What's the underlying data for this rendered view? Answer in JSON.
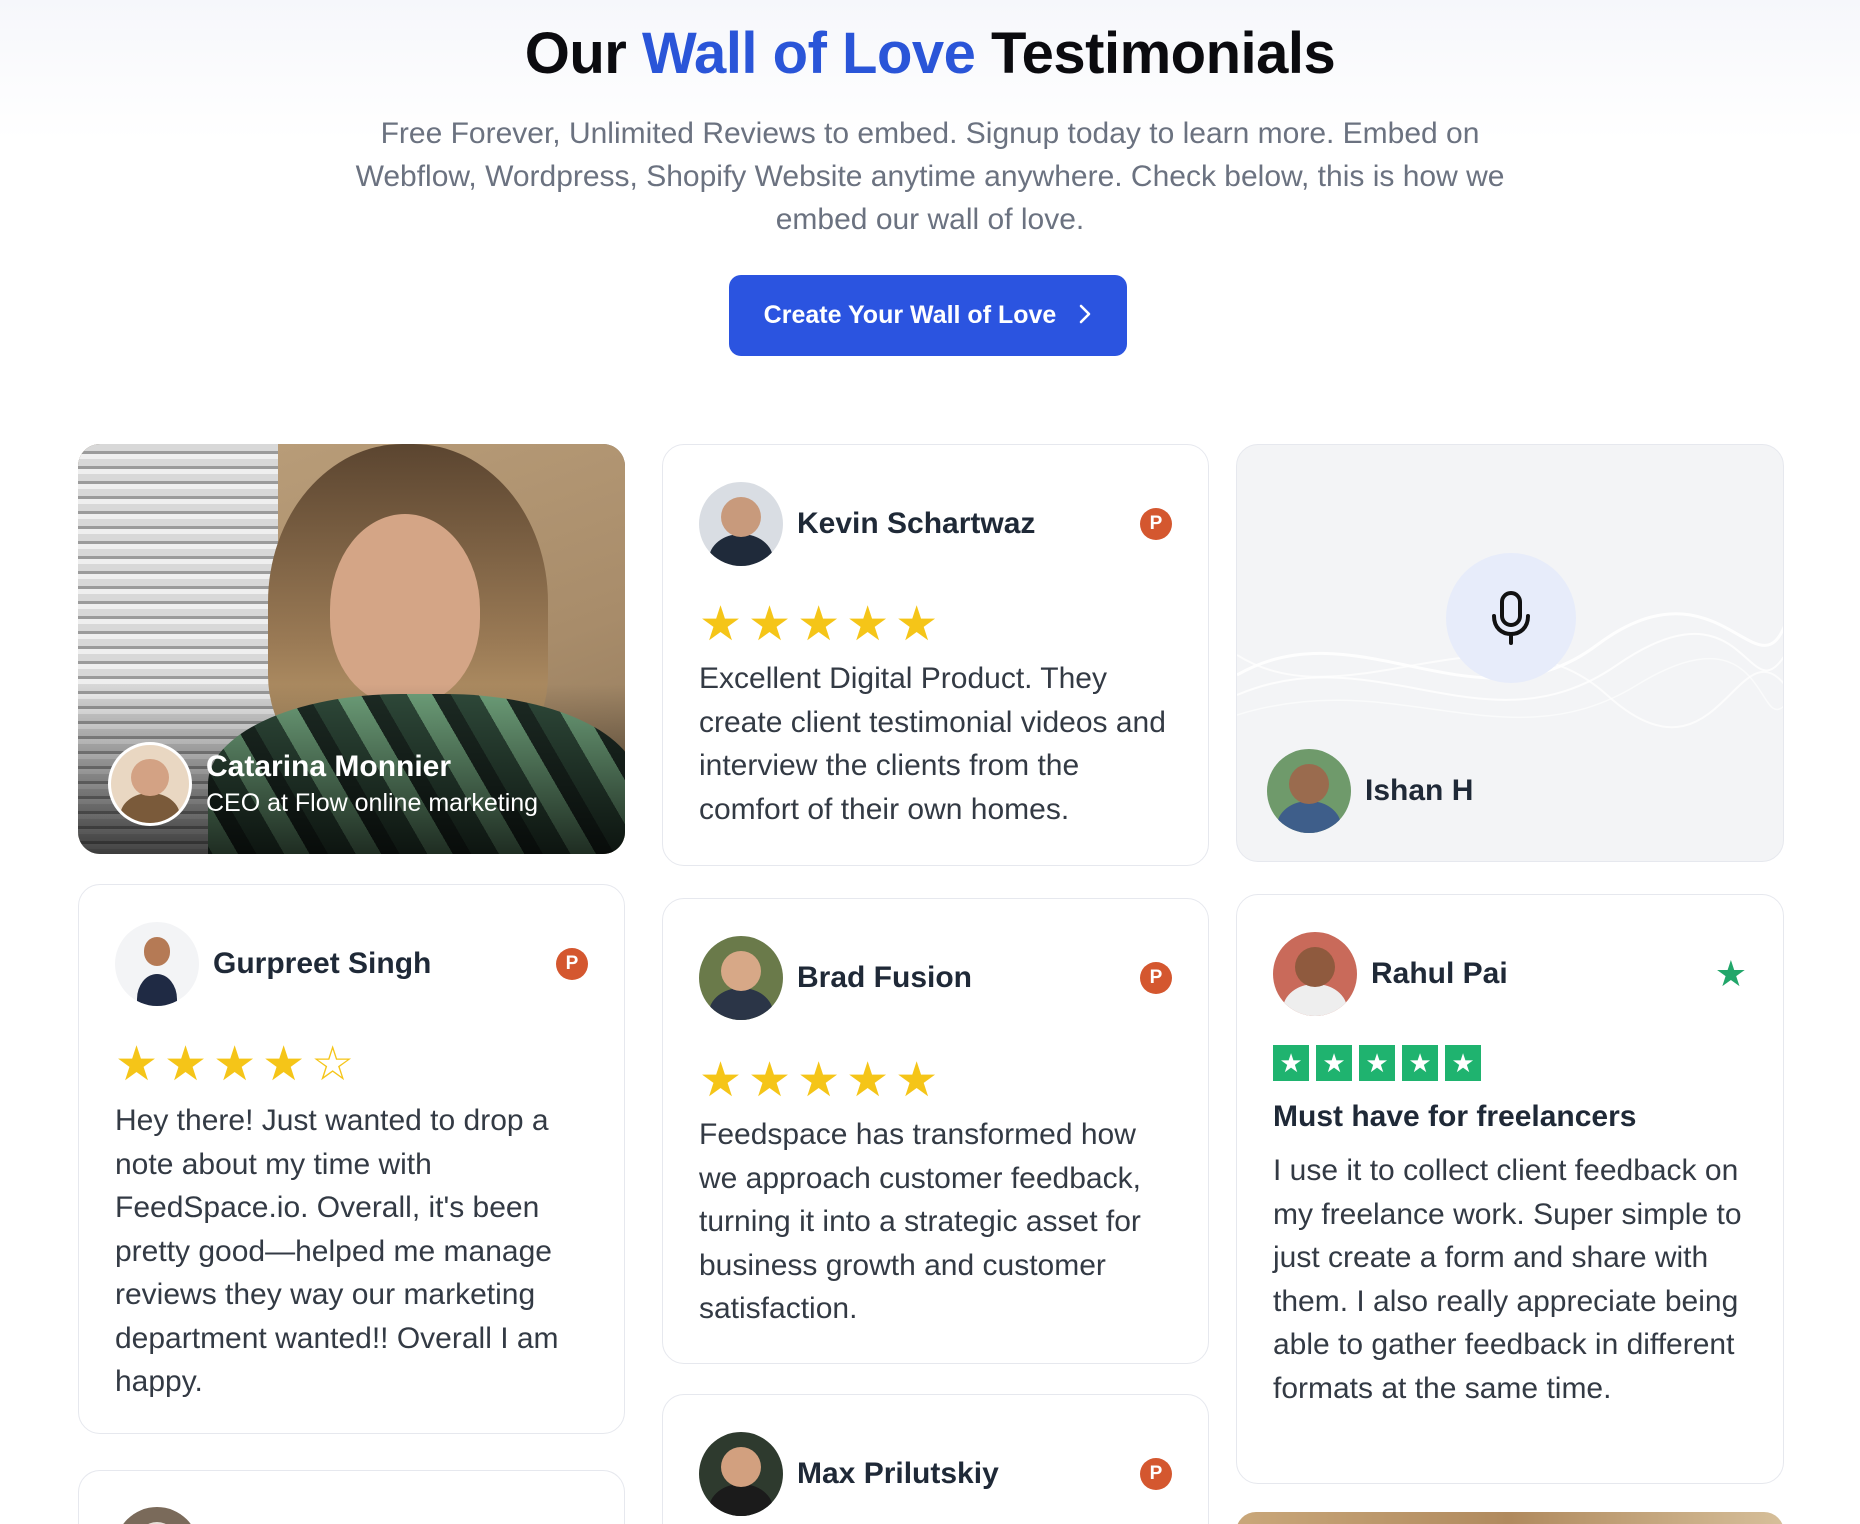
{
  "header": {
    "title_part1": "Our",
    "title_accent": "Wall of Love",
    "title_part2": "Testimonials",
    "subtitle": "Free Forever, Unlimited Reviews to embed. Signup today to learn more. Embed on Webflow, Wordpress, Shopify Website anytime anywhere. Check below, this is how we embed our wall of love.",
    "cta_label": "Create Your Wall of Love",
    "accent_color": "#2a55d8",
    "cta_color": "#2b54e0"
  },
  "icons": {
    "cta_chevron": "chevron-right-icon",
    "producthunt": "producthunt-icon",
    "trustpilot": "trustpilot-star-icon",
    "mic": "microphone-icon"
  },
  "testimonials": {
    "video": {
      "name": "Catarina Monnier",
      "role": "CEO at Flow online marketing"
    },
    "kevin": {
      "name": "Kevin Schartwaz",
      "badge": "P",
      "rating": 5,
      "stars": "★★★★★",
      "text": "Excellent Digital Product. They create client testimonial videos and interview the clients from the comfort of their own homes."
    },
    "ishan": {
      "name": "Ishan H"
    },
    "gurpreet": {
      "name": "Gurpreet Singh",
      "badge": "P",
      "rating": 4,
      "stars": "★★★★☆",
      "text": "Hey there! Just wanted to drop a note about my time with FeedSpace.io. Overall, it's been pretty good—helped me manage reviews they way our marketing department wanted!! Overall I am happy."
    },
    "brad": {
      "name": "Brad Fusion",
      "badge": "P",
      "rating": 5,
      "stars": "★★★★★",
      "text": "Feedspace has transformed how we approach customer feedback, turning it into a strategic asset for business growth and customer satisfaction."
    },
    "rahul": {
      "name": "Rahul Pai",
      "rating": 5,
      "trustpilot_star": "★",
      "tp_star_char": "★",
      "title": "Must have for freelancers",
      "text": "I use it to collect client feedback on my freelance work. Super simple to just create a form and share with them. I also really appreciate being able to gather feedback in different formats at the same time."
    },
    "max": {
      "name": "Max Prilutskiy",
      "badge": "P"
    }
  }
}
